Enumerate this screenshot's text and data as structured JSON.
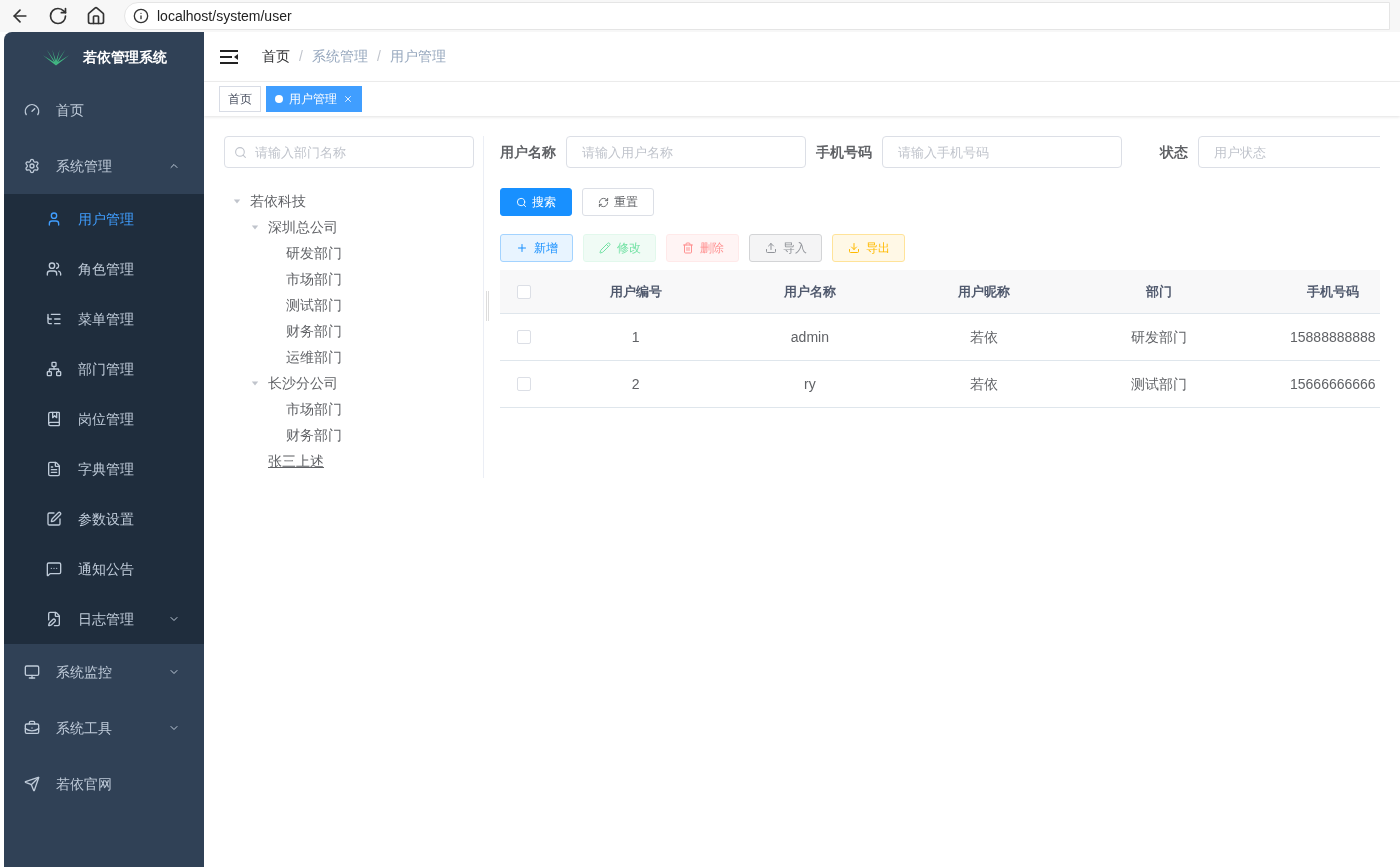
{
  "browser": {
    "url": "localhost/system/user"
  },
  "sidebar": {
    "title": "若依管理系统",
    "menu": [
      {
        "label": "首页",
        "kind": "link",
        "selected": false
      },
      {
        "label": "系统管理",
        "kind": "group",
        "expanded": true,
        "selected": false,
        "children": [
          {
            "label": "用户管理",
            "kind": "link",
            "selected": true
          },
          {
            "label": "角色管理",
            "kind": "link",
            "selected": false
          },
          {
            "label": "菜单管理",
            "kind": "link",
            "selected": false
          },
          {
            "label": "部门管理",
            "kind": "link",
            "selected": false
          },
          {
            "label": "岗位管理",
            "kind": "link",
            "selected": false
          },
          {
            "label": "字典管理",
            "kind": "link",
            "selected": false
          },
          {
            "label": "参数设置",
            "kind": "link",
            "selected": false
          },
          {
            "label": "通知公告",
            "kind": "link",
            "selected": false
          },
          {
            "label": "日志管理",
            "kind": "group",
            "expanded": false,
            "selected": false
          }
        ]
      },
      {
        "label": "系统监控",
        "kind": "group",
        "expanded": false,
        "selected": false
      },
      {
        "label": "系统工具",
        "kind": "group",
        "expanded": false,
        "selected": false
      },
      {
        "label": "若依官网",
        "kind": "link",
        "selected": false
      }
    ]
  },
  "breadcrumb_separator": "/",
  "breadcrumb": [
    {
      "label": "首页",
      "clickable": true
    },
    {
      "label": "系统管理",
      "clickable": false
    },
    {
      "label": "用户管理",
      "clickable": false
    }
  ],
  "tags": [
    {
      "label": "首页",
      "selected": false
    },
    {
      "label": "用户管理",
      "selected": true
    }
  ],
  "dept_search": {
    "placeholder": "请输入部门名称"
  },
  "dept_tree": [
    {
      "label": "若依科技",
      "expanded": true,
      "children": [
        {
          "label": "深圳总公司",
          "expanded": true,
          "children": [
            {
              "label": "研发部门"
            },
            {
              "label": "市场部门"
            },
            {
              "label": "测试部门"
            },
            {
              "label": "财务部门"
            },
            {
              "label": "运维部门"
            }
          ]
        },
        {
          "label": "长沙分公司",
          "expanded": true,
          "children": [
            {
              "label": "市场部门"
            },
            {
              "label": "财务部门"
            }
          ]
        },
        {
          "label": "张三上述",
          "hovered": true
        }
      ]
    }
  ],
  "filters": [
    {
      "label": "用户名称",
      "placeholder": "请输入用户名称"
    },
    {
      "label": "手机号码",
      "placeholder": "请输入手机号码"
    },
    {
      "label": "状态",
      "placeholder": "用户状态"
    }
  ],
  "query_buttons": [
    {
      "label": "搜索",
      "kind": "primary"
    },
    {
      "label": "重置",
      "kind": "default"
    }
  ],
  "toolbar": [
    {
      "label": "新增",
      "kind": "primary",
      "disabled": false
    },
    {
      "label": "修改",
      "kind": "success",
      "disabled": true
    },
    {
      "label": "删除",
      "kind": "danger",
      "disabled": true
    },
    {
      "label": "导入",
      "kind": "info",
      "disabled": false
    },
    {
      "label": "导出",
      "kind": "warning",
      "disabled": false
    }
  ],
  "table": {
    "select_all": false,
    "columns": [
      "用户编号",
      "用户名称",
      "用户昵称",
      "部门",
      "手机号码"
    ],
    "rows": [
      {
        "checked": false,
        "cells": [
          "1",
          "admin",
          "若依",
          "研发部门",
          "15888888888"
        ]
      },
      {
        "checked": false,
        "cells": [
          "2",
          "ry",
          "若依",
          "测试部门",
          "15666666666"
        ]
      }
    ]
  }
}
